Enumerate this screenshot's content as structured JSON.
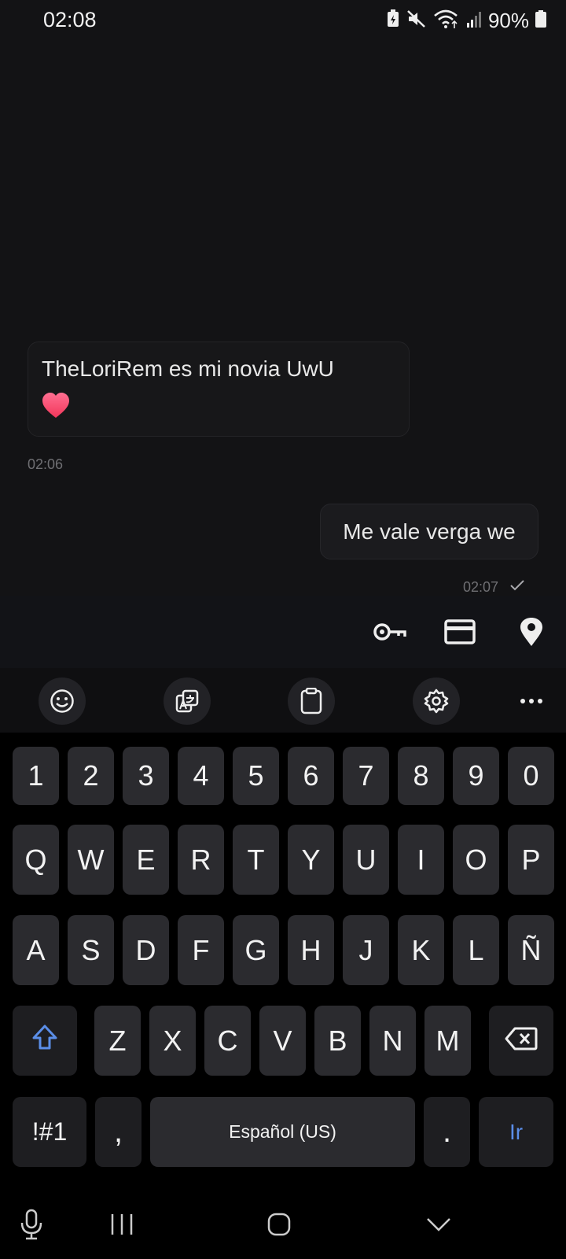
{
  "status_bar": {
    "time": "02:08",
    "battery": "90%",
    "icons": [
      "battery-saver-icon",
      "mute-icon",
      "wifi-icon",
      "signal-icon",
      "battery-icon"
    ]
  },
  "chat": {
    "incoming": {
      "text": "TheLoriRem es mi novia UwU",
      "emoji": "heart-icon",
      "time": "02:06"
    },
    "outgoing": {
      "text": "Me vale verga we",
      "time": "02:07",
      "status_icon": "check-icon"
    }
  },
  "autofill": {
    "icons": [
      "key-icon",
      "card-icon",
      "location-icon"
    ]
  },
  "keyboard_toolbar": {
    "icons": [
      "emoji-icon",
      "translate-icon",
      "clipboard-icon",
      "settings-icon",
      "more-icon"
    ]
  },
  "keyboard": {
    "row_numbers": [
      "1",
      "2",
      "3",
      "4",
      "5",
      "6",
      "7",
      "8",
      "9",
      "0"
    ],
    "row_1": [
      "Q",
      "W",
      "E",
      "R",
      "T",
      "Y",
      "U",
      "I",
      "O",
      "P"
    ],
    "row_2": [
      "A",
      "S",
      "D",
      "F",
      "G",
      "H",
      "J",
      "K",
      "L",
      "Ñ"
    ],
    "row_3": [
      "Z",
      "X",
      "C",
      "V",
      "B",
      "N",
      "M"
    ],
    "symbols_label": "!#1",
    "comma_label": ",",
    "space_label": "Español (US)",
    "period_label": ".",
    "enter_label": "Ir",
    "accent_color": "#5b8ee8"
  },
  "nav_bar": {
    "icons": [
      "mic-icon",
      "recents-icon",
      "home-icon",
      "back-icon"
    ]
  }
}
